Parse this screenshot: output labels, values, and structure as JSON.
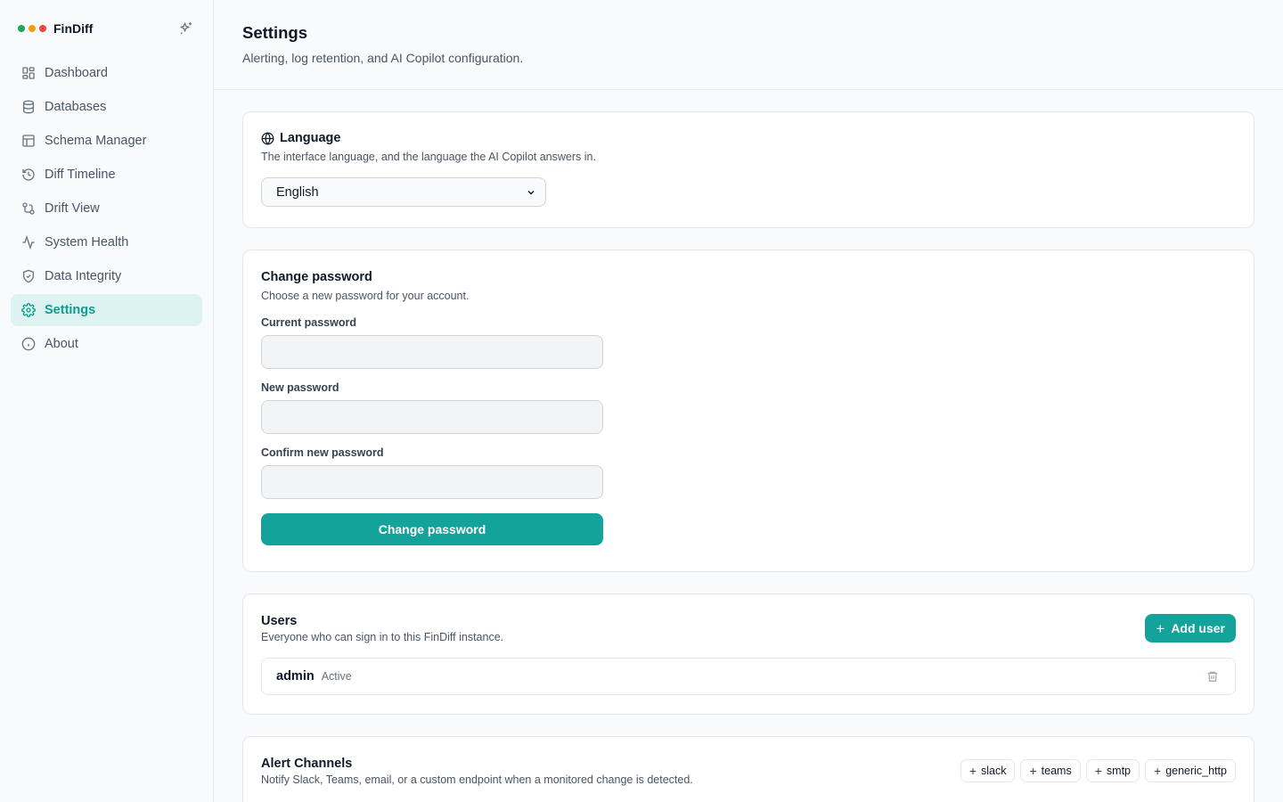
{
  "app": {
    "name": "FinDiff",
    "dots": [
      "#22a55b",
      "#f59e0b",
      "#ef4444"
    ]
  },
  "sidebar": {
    "items": [
      {
        "label": "Dashboard",
        "icon": "dashboard-icon"
      },
      {
        "label": "Databases",
        "icon": "database-icon"
      },
      {
        "label": "Schema Manager",
        "icon": "table-icon"
      },
      {
        "label": "Diff Timeline",
        "icon": "history-icon"
      },
      {
        "label": "Drift View",
        "icon": "git-compare-icon"
      },
      {
        "label": "System Health",
        "icon": "activity-icon"
      },
      {
        "label": "Data Integrity",
        "icon": "shield-check-icon"
      },
      {
        "label": "Settings",
        "icon": "gear-icon",
        "active": true
      },
      {
        "label": "About",
        "icon": "info-icon"
      }
    ]
  },
  "header": {
    "title": "Settings",
    "subtitle": "Alerting, log retention, and AI Copilot configuration."
  },
  "language": {
    "title": "Language",
    "description": "The interface language, and the language the AI Copilot answers in.",
    "selected": "English"
  },
  "password": {
    "title": "Change password",
    "description": "Choose a new password for your account.",
    "current_label": "Current password",
    "new_label": "New password",
    "confirm_label": "Confirm new password",
    "button_label": "Change password"
  },
  "users": {
    "title": "Users",
    "description": "Everyone who can sign in to this FinDiff instance.",
    "add_label": "Add user",
    "rows": [
      {
        "name": "admin",
        "status": "Active"
      }
    ]
  },
  "alerts": {
    "title": "Alert Channels",
    "description": "Notify Slack, Teams, email, or a custom endpoint when a monitored change is detected.",
    "channels": [
      "slack",
      "teams",
      "smtp",
      "generic_http"
    ]
  },
  "colors": {
    "accent": "#14a39a",
    "active_bg": "#ddf3f1"
  }
}
